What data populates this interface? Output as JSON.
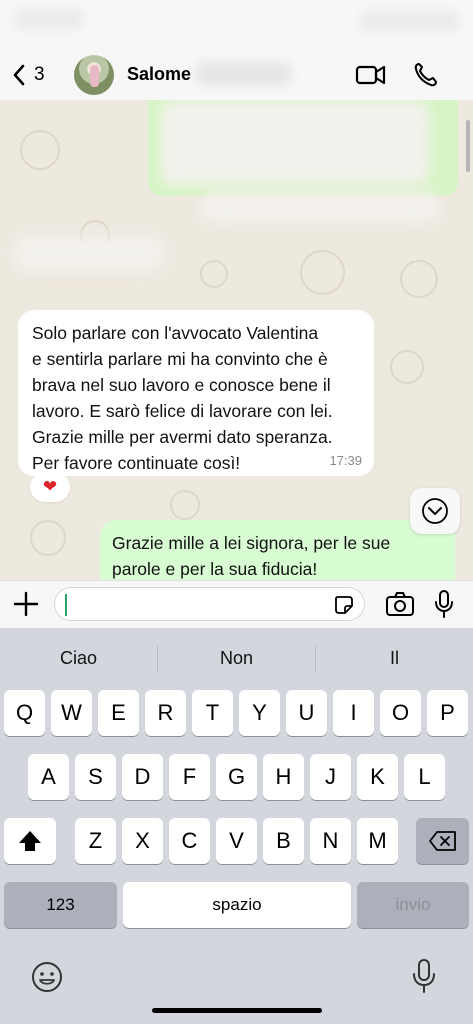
{
  "header": {
    "back_count": "3",
    "contact_name": "Salome"
  },
  "messages": {
    "incoming": {
      "text": "Solo parlare con l'avvocato Valentina\ne sentirla parlare mi ha convinto che è\nbrava nel suo lavoro e conosce bene il\nlavoro. E sarò felice di lavorare con lei.\nGrazie mille per avermi dato speranza.\nPer favore continuate così!",
      "time": "17:39",
      "reaction": "❤"
    },
    "outgoing": {
      "text": "Grazie mille a lei signora, per le sue\nparole e per la sua fiducia!"
    }
  },
  "keyboard": {
    "suggestions": [
      "Ciao",
      "Non",
      "Il"
    ],
    "row1": [
      "Q",
      "W",
      "E",
      "R",
      "T",
      "Y",
      "U",
      "I",
      "O",
      "P"
    ],
    "row2": [
      "A",
      "S",
      "D",
      "F",
      "G",
      "H",
      "J",
      "K",
      "L"
    ],
    "row3": [
      "Z",
      "X",
      "C",
      "V",
      "B",
      "N",
      "M"
    ],
    "numbers_label": "123",
    "space_label": "spazio",
    "return_label": "invio"
  },
  "colors": {
    "outgoing_bubble": "#d9fdd3",
    "chat_background": "#eee9df",
    "reaction_heart": "#e0242e"
  },
  "icons": [
    "chevron-left-icon",
    "video-call-icon",
    "phone-icon",
    "chevron-down-icon",
    "plus-icon",
    "sticker-icon",
    "camera-icon",
    "mic-icon",
    "shift-icon",
    "backspace-icon",
    "emoji-icon",
    "dictation-icon"
  ]
}
